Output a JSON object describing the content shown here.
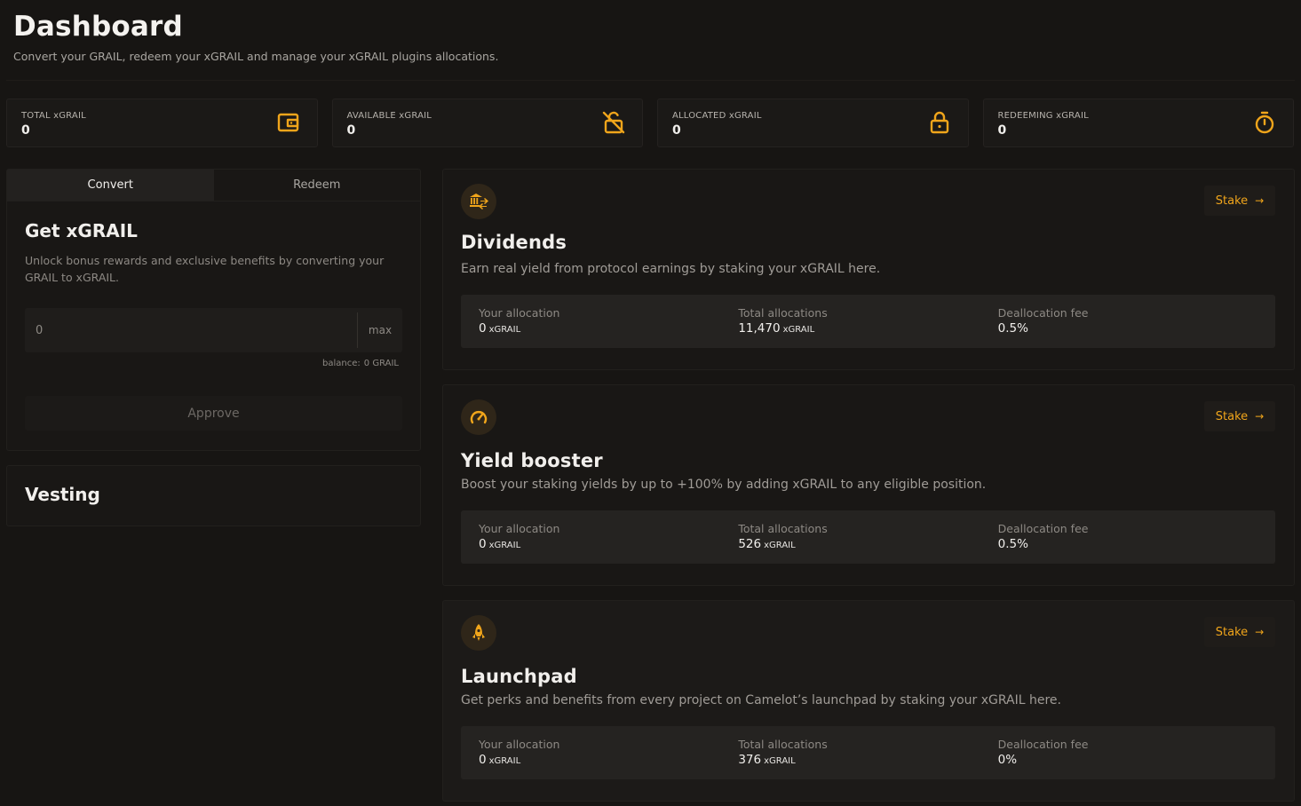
{
  "header": {
    "title": "Dashboard",
    "subtitle": "Convert your GRAIL, redeem your xGRAIL and manage your xGRAIL plugins allocations."
  },
  "stats": [
    {
      "label": "TOTAL xGRAIL",
      "value": "0",
      "icon": "wallet-icon"
    },
    {
      "label": "AVAILABLE xGRAIL",
      "value": "0",
      "icon": "unlock-icon"
    },
    {
      "label": "ALLOCATED xGRAIL",
      "value": "0",
      "icon": "lock-icon"
    },
    {
      "label": "REDEEMING xGRAIL",
      "value": "0",
      "icon": "timer-icon"
    }
  ],
  "convert": {
    "tabs": [
      "Convert",
      "Redeem"
    ],
    "active_tab": "Convert",
    "title": "Get xGRAIL",
    "description": "Unlock bonus rewards and exclusive benefits by converting your GRAIL to xGRAIL.",
    "input_placeholder": "0",
    "max_label": "max",
    "balance_label": "balance:",
    "balance_value": "0 GRAIL",
    "approve_label": "Approve"
  },
  "vesting": {
    "title": "Vesting"
  },
  "plugins": [
    {
      "title": "Dividends",
      "description": "Earn real yield from protocol earnings by staking your xGRAIL here.",
      "icon": "bank-transfer-icon",
      "stake_label": "Stake",
      "your_allocation_label": "Your allocation",
      "your_allocation": "0",
      "total_allocations_label": "Total allocations",
      "total_allocations": "11,470",
      "unit": "xGRAIL",
      "fee_label": "Deallocation fee",
      "fee": "0.5%"
    },
    {
      "title": "Yield booster",
      "description": "Boost your staking yields by up to +100% by adding xGRAIL to any eligible position.",
      "icon": "speedometer-icon",
      "stake_label": "Stake",
      "your_allocation_label": "Your allocation",
      "your_allocation": "0",
      "total_allocations_label": "Total allocations",
      "total_allocations": "526",
      "unit": "xGRAIL",
      "fee_label": "Deallocation fee",
      "fee": "0.5%"
    },
    {
      "title": "Launchpad",
      "description": "Get perks and benefits from every project on Camelot’s launchpad by staking your xGRAIL here.",
      "icon": "rocket-icon",
      "stake_label": "Stake",
      "your_allocation_label": "Your allocation",
      "your_allocation": "0",
      "total_allocations_label": "Total allocations",
      "total_allocations": "376",
      "unit": "xGRAIL",
      "fee_label": "Deallocation fee",
      "fee": "0%"
    }
  ],
  "colors": {
    "background": "#171513",
    "card": "#1b1917",
    "accent": "#f0a51b",
    "muted_text": "#8d8984"
  }
}
